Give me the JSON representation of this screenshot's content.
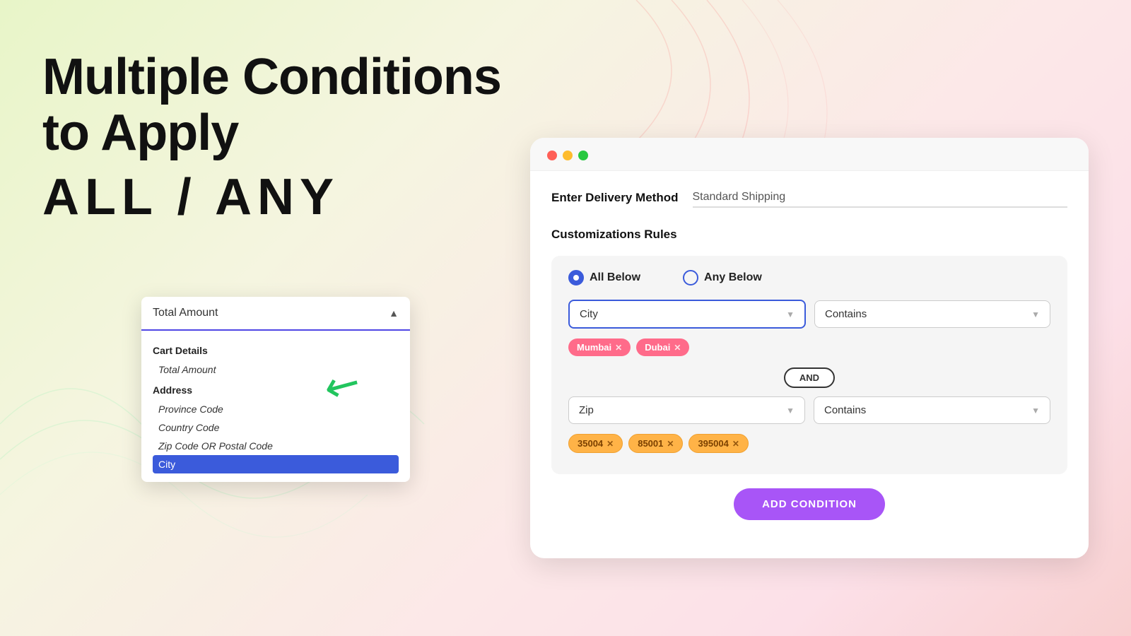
{
  "background": {
    "color_start": "#e8f5c8",
    "color_end": "#f8d0d0"
  },
  "left": {
    "title_line1": "Multiple Conditions",
    "title_line2": "to Apply",
    "title_line3": "ALL / ANY"
  },
  "dropdown": {
    "trigger_value": "Total Amount",
    "groups": [
      {
        "label": "Cart Details",
        "items": [
          {
            "text": "Total Amount",
            "selected": false
          }
        ]
      },
      {
        "label": "Address",
        "items": [
          {
            "text": "Province Code",
            "selected": false
          },
          {
            "text": "Country Code",
            "selected": false
          },
          {
            "text": "Zip Code OR Postal Code",
            "selected": false
          },
          {
            "text": "City",
            "selected": true
          }
        ]
      }
    ]
  },
  "panel": {
    "window_controls": [
      "red",
      "yellow",
      "green"
    ],
    "delivery_label": "Enter Delivery Method",
    "delivery_placeholder": "Standard Shipping",
    "section_title": "Customizations Rules",
    "rules": {
      "option_all": "All Below",
      "option_any": "Any Below",
      "selected": "all",
      "conditions": [
        {
          "field": "City",
          "operator": "Contains",
          "tags_pink": [
            "Mumbai",
            "Dubai"
          ]
        },
        {
          "connector": "AND"
        },
        {
          "field": "Zip",
          "operator": "Contains",
          "tags_orange": [
            "35004",
            "85001",
            "395004"
          ]
        }
      ]
    },
    "add_condition_label": "ADD CONDITION"
  }
}
